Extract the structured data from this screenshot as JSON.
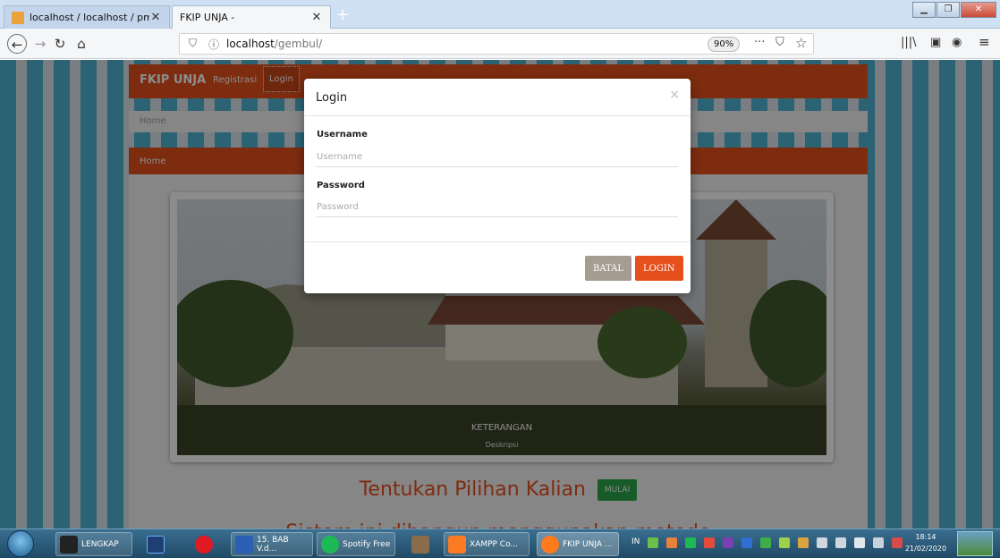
{
  "browser": {
    "tabs": [
      {
        "label": "localhost / localhost / pm | php",
        "close": "✕"
      },
      {
        "label": "FKIP UNJA -",
        "close": "✕"
      }
    ],
    "new_tab": "+",
    "url_host": "localhost",
    "url_path": "/gembul/",
    "zoom": "90%"
  },
  "site": {
    "brand": "FKIP UNJA",
    "nav": [
      "Registrasi",
      "Login"
    ],
    "breadcrumb": "Home",
    "panel_title": "Home",
    "carousel": {
      "caption_title": "KETERANGAN",
      "caption_desc": "Deskripsi"
    },
    "headline": "Tentukan Pilihan Kalian",
    "cta_label": "MULAI",
    "subline": "Sistem ini dibangun menggunakan metode"
  },
  "modal": {
    "title": "Login",
    "close": "×",
    "username_label": "Username",
    "username_placeholder": "Username",
    "password_label": "Password",
    "password_placeholder": "Password",
    "cancel_label": "BATAL",
    "submit_label": "LOGIN"
  },
  "taskbar": {
    "items": [
      "LENGKAP",
      "15. BAB V.d...",
      "Spotify Free",
      "XAMPP Co...",
      "FKIP UNJA ..."
    ],
    "language": "IN",
    "time": "18:14",
    "date": "21/02/2020"
  },
  "colors": {
    "accent": "#e5501d",
    "success": "#2aa84a",
    "muted": "#a59d91"
  }
}
